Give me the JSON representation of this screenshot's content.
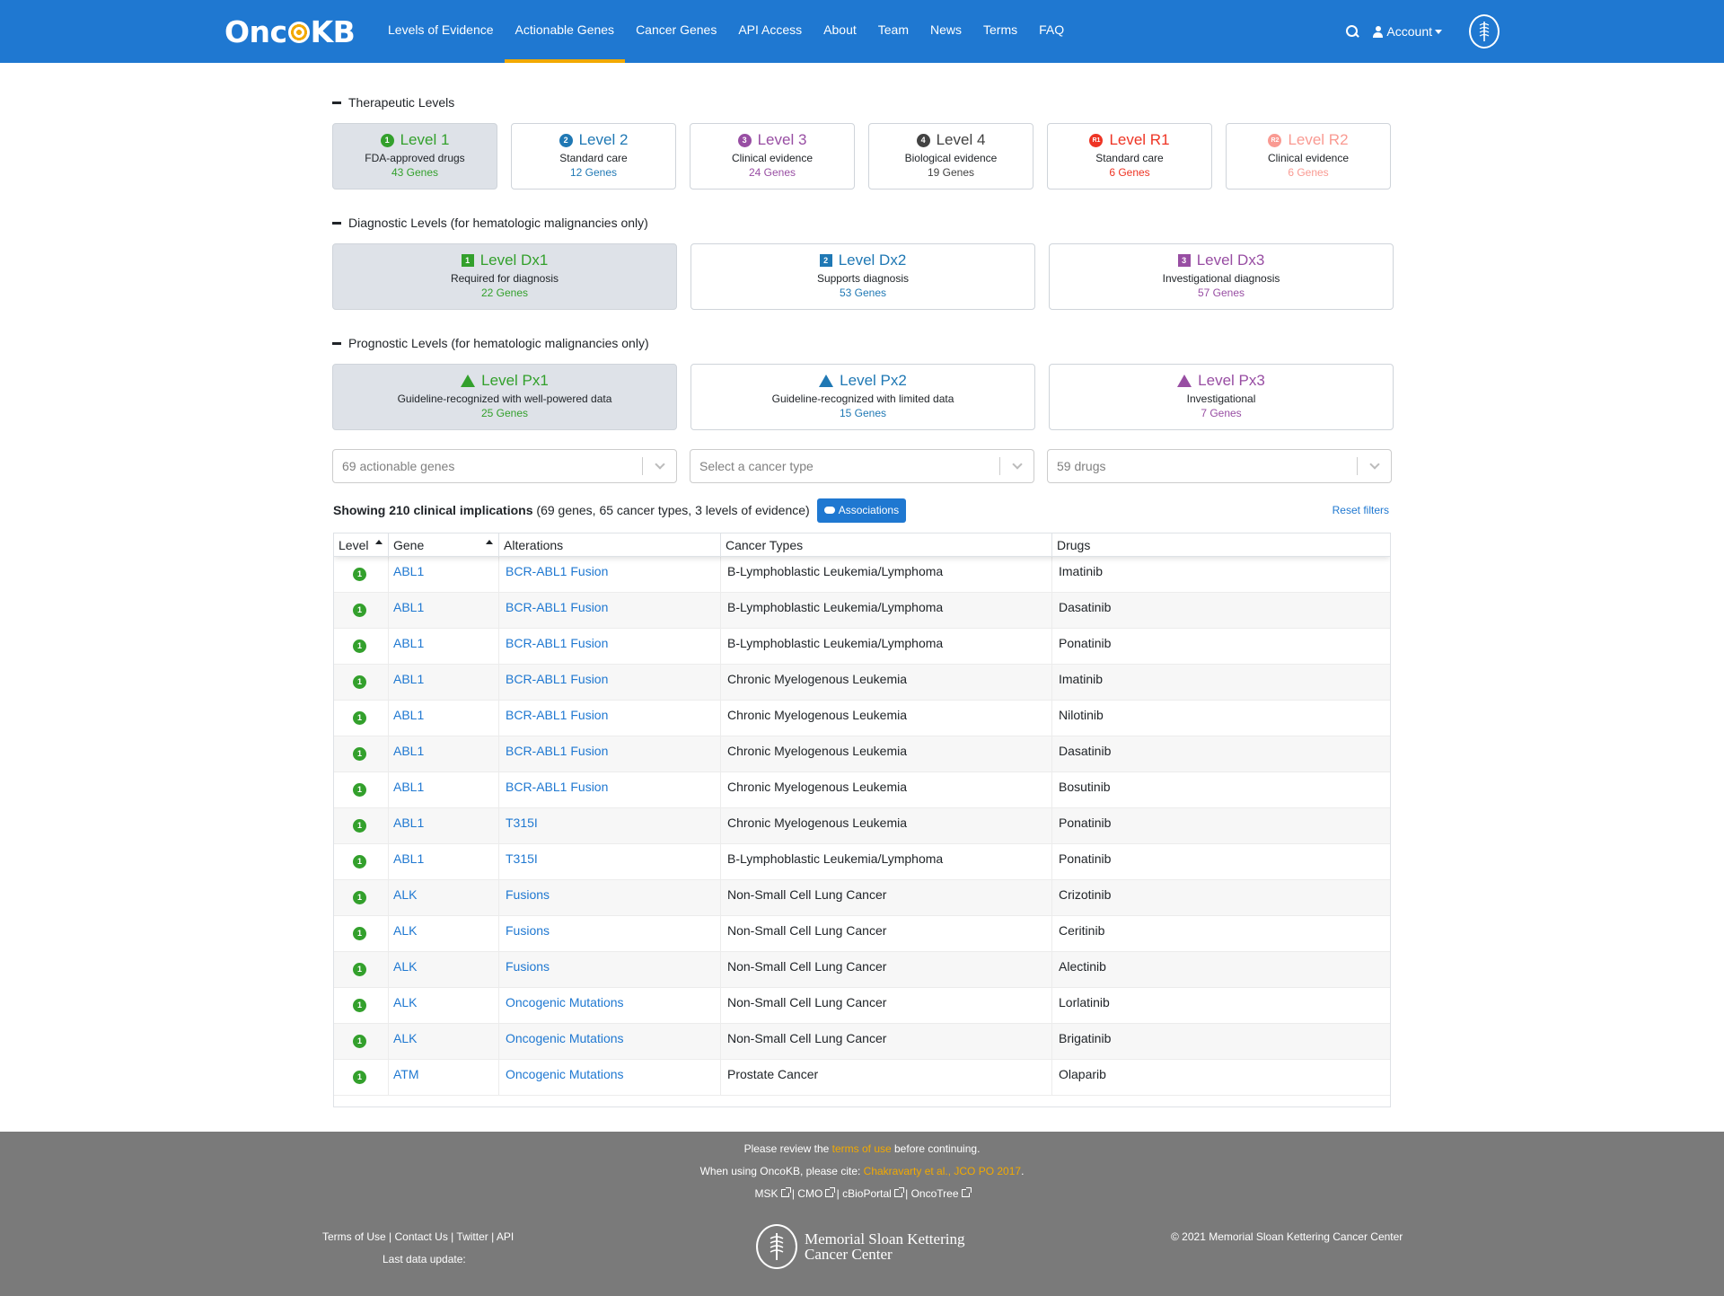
{
  "nav": {
    "logo_left": "Onc",
    "logo_right": "KB",
    "links": [
      {
        "label": "Levels of Evidence",
        "active": false
      },
      {
        "label": "Actionable Genes",
        "active": true
      },
      {
        "label": "Cancer Genes",
        "active": false
      },
      {
        "label": "API Access",
        "active": false
      },
      {
        "label": "About",
        "active": false
      },
      {
        "label": "Team",
        "active": false
      },
      {
        "label": "News",
        "active": false
      },
      {
        "label": "Terms",
        "active": false
      },
      {
        "label": "FAQ",
        "active": false
      }
    ],
    "account_label": "Account"
  },
  "therapeutic": {
    "title": "Therapeutic Levels",
    "cards": [
      {
        "badge": "1",
        "title": "Level 1",
        "desc": "FDA-approved drugs",
        "count": "43 Genes",
        "color": "#33a02c"
      },
      {
        "badge": "2",
        "title": "Level 2",
        "desc": "Standard care",
        "count": "12 Genes",
        "color": "#1f78b4"
      },
      {
        "badge": "3",
        "title": "Level 3",
        "desc": "Clinical evidence",
        "count": "24 Genes",
        "color": "#984ea3"
      },
      {
        "badge": "4",
        "title": "Level 4",
        "desc": "Biological evidence",
        "count": "19 Genes",
        "color": "#424242"
      },
      {
        "badge": "R1",
        "title": "Level R1",
        "desc": "Standard care",
        "count": "6 Genes",
        "color": "#ee3424"
      },
      {
        "badge": "R2",
        "title": "Level R2",
        "desc": "Clinical evidence",
        "count": "6 Genes",
        "color": "#f99a92"
      }
    ]
  },
  "diagnostic": {
    "title": "Diagnostic Levels (for hematologic malignancies only)",
    "cards": [
      {
        "badge": "1",
        "title": "Level Dx1",
        "desc": "Required for diagnosis",
        "count": "22 Genes",
        "color": "#33a02c"
      },
      {
        "badge": "2",
        "title": "Level Dx2",
        "desc": "Supports diagnosis",
        "count": "53 Genes",
        "color": "#1f78b4"
      },
      {
        "badge": "3",
        "title": "Level Dx3",
        "desc": "Investigational diagnosis",
        "count": "57 Genes",
        "color": "#984ea3"
      }
    ]
  },
  "prognostic": {
    "title": "Prognostic Levels (for hematologic malignancies only)",
    "cards": [
      {
        "badge": "1",
        "title": "Level Px1",
        "desc": "Guideline-recognized with well-powered data",
        "count": "25 Genes",
        "color": "#33a02c"
      },
      {
        "badge": "2",
        "title": "Level Px2",
        "desc": "Guideline-recognized with limited data",
        "count": "15 Genes",
        "color": "#1f78b4"
      },
      {
        "badge": "3",
        "title": "Level Px3",
        "desc": "Investigational",
        "count": "7 Genes",
        "color": "#984ea3"
      }
    ]
  },
  "filters": {
    "genes_placeholder": "69 actionable genes",
    "cancer_placeholder": "Select a cancer type",
    "drugs_placeholder": "59 drugs"
  },
  "summary": {
    "bold": "Showing 210 clinical implications",
    "rest": " (69 genes, 65 cancer types, 3 levels of evidence)",
    "button": "Associations",
    "reset": "Reset filters"
  },
  "table": {
    "headers": [
      "Level",
      "Gene",
      "Alterations",
      "Cancer Types",
      "Drugs"
    ],
    "rows": [
      {
        "level": "1",
        "gene": "ABL1",
        "alteration": "BCR-ABL1 Fusion",
        "cancer": "B-Lymphoblastic Leukemia/Lymphoma",
        "drug": "Imatinib"
      },
      {
        "level": "1",
        "gene": "ABL1",
        "alteration": "BCR-ABL1 Fusion",
        "cancer": "B-Lymphoblastic Leukemia/Lymphoma",
        "drug": "Dasatinib"
      },
      {
        "level": "1",
        "gene": "ABL1",
        "alteration": "BCR-ABL1 Fusion",
        "cancer": "B-Lymphoblastic Leukemia/Lymphoma",
        "drug": "Ponatinib"
      },
      {
        "level": "1",
        "gene": "ABL1",
        "alteration": "BCR-ABL1 Fusion",
        "cancer": "Chronic Myelogenous Leukemia",
        "drug": "Imatinib"
      },
      {
        "level": "1",
        "gene": "ABL1",
        "alteration": "BCR-ABL1 Fusion",
        "cancer": "Chronic Myelogenous Leukemia",
        "drug": "Nilotinib"
      },
      {
        "level": "1",
        "gene": "ABL1",
        "alteration": "BCR-ABL1 Fusion",
        "cancer": "Chronic Myelogenous Leukemia",
        "drug": "Dasatinib"
      },
      {
        "level": "1",
        "gene": "ABL1",
        "alteration": "BCR-ABL1 Fusion",
        "cancer": "Chronic Myelogenous Leukemia",
        "drug": "Bosutinib"
      },
      {
        "level": "1",
        "gene": "ABL1",
        "alteration": "T315I",
        "cancer": "Chronic Myelogenous Leukemia",
        "drug": "Ponatinib"
      },
      {
        "level": "1",
        "gene": "ABL1",
        "alteration": "T315I",
        "cancer": "B-Lymphoblastic Leukemia/Lymphoma",
        "drug": "Ponatinib"
      },
      {
        "level": "1",
        "gene": "ALK",
        "alteration": "Fusions",
        "cancer": "Non-Small Cell Lung Cancer",
        "drug": "Crizotinib"
      },
      {
        "level": "1",
        "gene": "ALK",
        "alteration": "Fusions",
        "cancer": "Non-Small Cell Lung Cancer",
        "drug": "Ceritinib"
      },
      {
        "level": "1",
        "gene": "ALK",
        "alteration": "Fusions",
        "cancer": "Non-Small Cell Lung Cancer",
        "drug": "Alectinib"
      },
      {
        "level": "1",
        "gene": "ALK",
        "alteration": "Oncogenic Mutations",
        "cancer": "Non-Small Cell Lung Cancer",
        "drug": "Lorlatinib"
      },
      {
        "level": "1",
        "gene": "ALK",
        "alteration": "Oncogenic Mutations",
        "cancer": "Non-Small Cell Lung Cancer",
        "drug": "Brigatinib"
      },
      {
        "level": "1",
        "gene": "ATM",
        "alteration": "Oncogenic Mutations",
        "cancer": "Prostate Cancer",
        "drug": "Olaparib"
      }
    ]
  },
  "footer": {
    "review_pre": "Please review the ",
    "review_link": "terms of use",
    "review_post": " before continuing.",
    "cite_pre": "When using OncoKB, please cite: ",
    "cite_link": "Chakravarty et al., JCO PO 2017",
    "cite_post": ".",
    "ext_links": [
      "MSK",
      "CMO",
      "cBioPortal",
      "OncoTree"
    ],
    "left_links": [
      "Terms of Use",
      "Contact Us",
      "Twitter",
      "API"
    ],
    "last_update": "Last data update:",
    "msk_line1": "Memorial Sloan Kettering",
    "msk_line2": "Cancer Center",
    "copyright": "© 2021 Memorial Sloan Kettering Cancer Center"
  },
  "colors": {
    "brand": "#1f78d1",
    "accent": "#f2a900",
    "footer": "#7a7a7a"
  }
}
